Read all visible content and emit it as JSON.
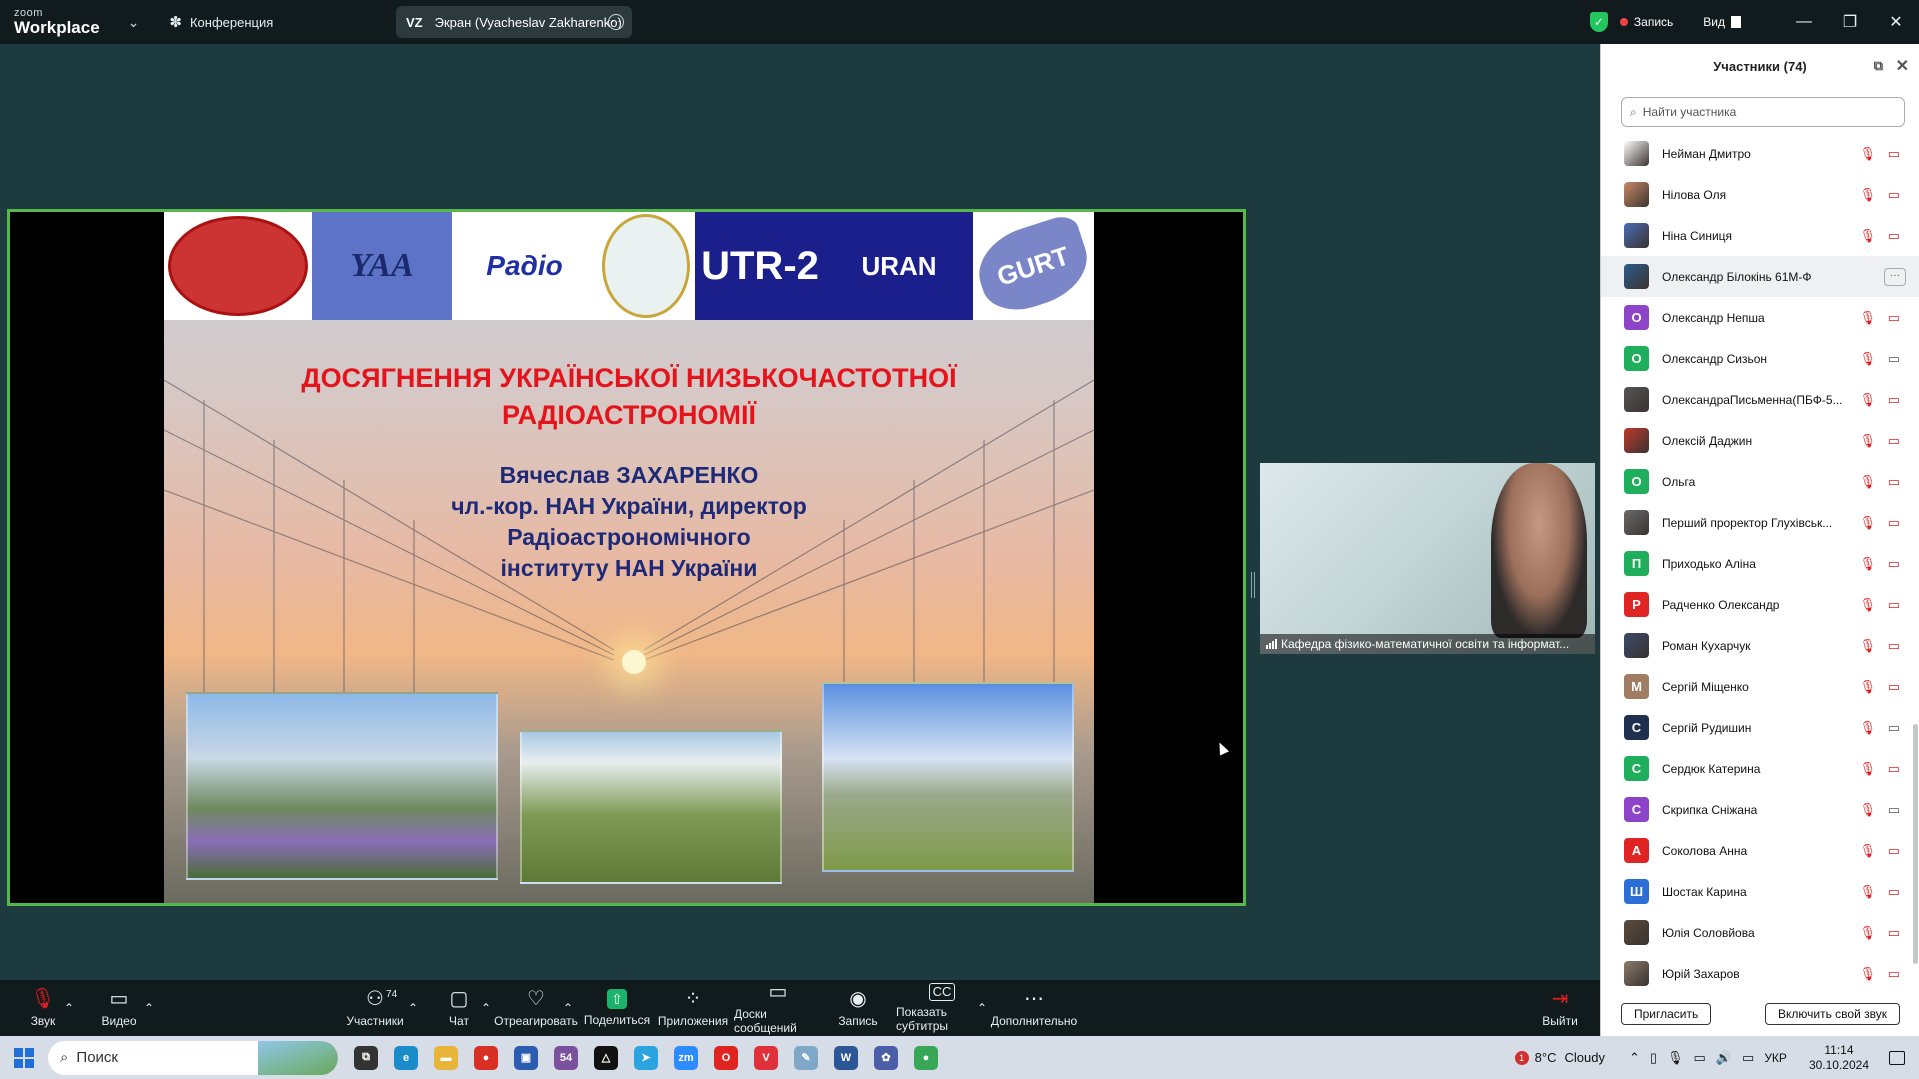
{
  "topbar": {
    "logo_small": "zoom",
    "logo_big": "Workplace",
    "meeting_label": "Конференция",
    "screen_initials": "VZ",
    "screen_label": "Экран (Vyacheslav Zakharenko)",
    "record_label": "Запись",
    "view_label": "Вид",
    "win_minimize": "—",
    "win_restore": "❐",
    "win_close": "✕"
  },
  "slide": {
    "logo_texts": [
      "YAA",
      "Радіо",
      "UTR-2",
      "URAN",
      "GURT"
    ],
    "title_line1": "ДОСЯГНЕННЯ УКРАЇНСЬКОЇ НИЗЬКОЧАСТОТНОЇ",
    "title_line2": "РАДІОАСТРОНОМІЇ",
    "author_line1": "Вячеслав ЗАХАРЕНКО",
    "author_line2": "чл.-кор. НАН України, директор",
    "author_line3": "Радіоастрономічного",
    "author_line4": "інституту НАН України"
  },
  "video_tile": {
    "label": "Кафедра фізико-математичної освіти та інформат..."
  },
  "participants": {
    "title": "Участники (74)",
    "search_placeholder": "Найти участника",
    "invite_button": "Пригласить",
    "unmute_button": "Включить свой звук",
    "items": [
      {
        "name": "Нейман Дмитро",
        "initial": "",
        "avatar_color": "#ffffff",
        "photo": true,
        "cam_on": false
      },
      {
        "name": "Нілова Оля",
        "initial": "",
        "avatar_color": "#c98a66",
        "photo": true,
        "cam_on": false
      },
      {
        "name": "Ніна Синиця",
        "initial": "",
        "avatar_color": "#4a6bb5",
        "photo": true,
        "cam_on": false
      },
      {
        "name": "Олександр Білокінь 61М-Ф",
        "initial": "",
        "avatar_color": "#2d5d8a",
        "photo": true,
        "cam_on": false,
        "highlight": true
      },
      {
        "name": "Олександр Непша",
        "initial": "О",
        "avatar_color": "#8e44c9",
        "photo": false,
        "cam_on": false
      },
      {
        "name": "Олександр Сизьон",
        "initial": "О",
        "avatar_color": "#1fae5b",
        "photo": false,
        "cam_on": true
      },
      {
        "name": "ОлександраПисьменна(ПБФ-5...",
        "initial": "",
        "avatar_color": "#555555",
        "photo": true,
        "cam_on": false
      },
      {
        "name": "Олексій Даджин",
        "initial": "",
        "avatar_color": "#c0392b",
        "photo": true,
        "cam_on": false
      },
      {
        "name": "Ольга",
        "initial": "О",
        "avatar_color": "#1fae5b",
        "photo": false,
        "cam_on": false
      },
      {
        "name": "Перший проректор Глухівськ...",
        "initial": "",
        "avatar_color": "#6b6b6b",
        "photo": true,
        "cam_on": false
      },
      {
        "name": "Приходько Аліна",
        "initial": "П",
        "avatar_color": "#1fae5b",
        "photo": false,
        "cam_on": false
      },
      {
        "name": "Радченко Олександр",
        "initial": "Р",
        "avatar_color": "#e02424",
        "photo": false,
        "cam_on": false
      },
      {
        "name": "Роман Кухарчук",
        "initial": "",
        "avatar_color": "#3b4a6b",
        "photo": true,
        "cam_on": false
      },
      {
        "name": "Сергій Міщенко",
        "initial": "М",
        "avatar_color": "#a07d62",
        "photo": false,
        "cam_on": false
      },
      {
        "name": "Сергій Рудишин",
        "initial": "С",
        "avatar_color": "#1e2f4f",
        "photo": false,
        "cam_on": true
      },
      {
        "name": "Сердюк Катерина",
        "initial": "С",
        "avatar_color": "#1fae5b",
        "photo": false,
        "cam_on": false
      },
      {
        "name": "Скрипка Сніжана",
        "initial": "С",
        "avatar_color": "#8e44c9",
        "photo": false,
        "cam_on": true
      },
      {
        "name": "Соколова Анна",
        "initial": "А",
        "avatar_color": "#e02424",
        "photo": false,
        "cam_on": false
      },
      {
        "name": "Шостак  Карина",
        "initial": "Ш",
        "avatar_color": "#2b6fd6",
        "photo": false,
        "cam_on": false
      },
      {
        "name": "Юлія Соловйова",
        "initial": "",
        "avatar_color": "#5a4a3a",
        "photo": true,
        "cam_on": false
      },
      {
        "name": "Юрій Захаров",
        "initial": "",
        "avatar_color": "#8a7a6a",
        "photo": true,
        "cam_on": false
      }
    ]
  },
  "toolbar": {
    "audio": "Звук",
    "video": "Видео",
    "participants": "Участники",
    "participants_count": "74",
    "chat": "Чат",
    "react": "Отреагировать",
    "share": "Поделиться",
    "apps": "Приложения",
    "whiteboards": "Доски сообщений",
    "record": "Запись",
    "captions": "Показать субтитры",
    "more": "Дополнительно",
    "leave": "Выйти"
  },
  "taskbar": {
    "search_label": "Поиск",
    "apps": [
      {
        "name": "task-view",
        "label": "⧉",
        "color": "#333333"
      },
      {
        "name": "edge",
        "label": "e",
        "color": "#1a8cc9"
      },
      {
        "name": "explorer",
        "label": "▬",
        "color": "#e8b53a"
      },
      {
        "name": "chrome",
        "label": "●",
        "color": "#d93025"
      },
      {
        "name": "save",
        "label": "▣",
        "color": "#2a5db0"
      },
      {
        "name": "viber",
        "label": "54",
        "color": "#7b519d"
      },
      {
        "name": "triangle-app",
        "label": "△",
        "color": "#111111"
      },
      {
        "name": "telegram",
        "label": "➤",
        "color": "#2aa3df"
      },
      {
        "name": "zoom",
        "label": "zm",
        "color": "#2d8cff"
      },
      {
        "name": "opera",
        "label": "O",
        "color": "#e0241f"
      },
      {
        "name": "vivaldi",
        "label": "V",
        "color": "#e0303a"
      },
      {
        "name": "paint",
        "label": "✎",
        "color": "#7fa8c8"
      },
      {
        "name": "word",
        "label": "W",
        "color": "#2b5797"
      },
      {
        "name": "settings-app",
        "label": "✿",
        "color": "#4a5fa8"
      },
      {
        "name": "chrome-profile",
        "label": "●",
        "color": "#3aa757"
      }
    ],
    "weather_alert": "1",
    "temperature": "8°C",
    "weather": "Cloudy",
    "language": "УКР",
    "time": "11:14",
    "date": "30.10.2024"
  },
  "colors": {
    "share_border": "#56b84a",
    "slide_title": "#e3141c",
    "slide_author": "#1e2a78",
    "muted_icon": "#e01e1e",
    "share_button": "#19b36b"
  }
}
